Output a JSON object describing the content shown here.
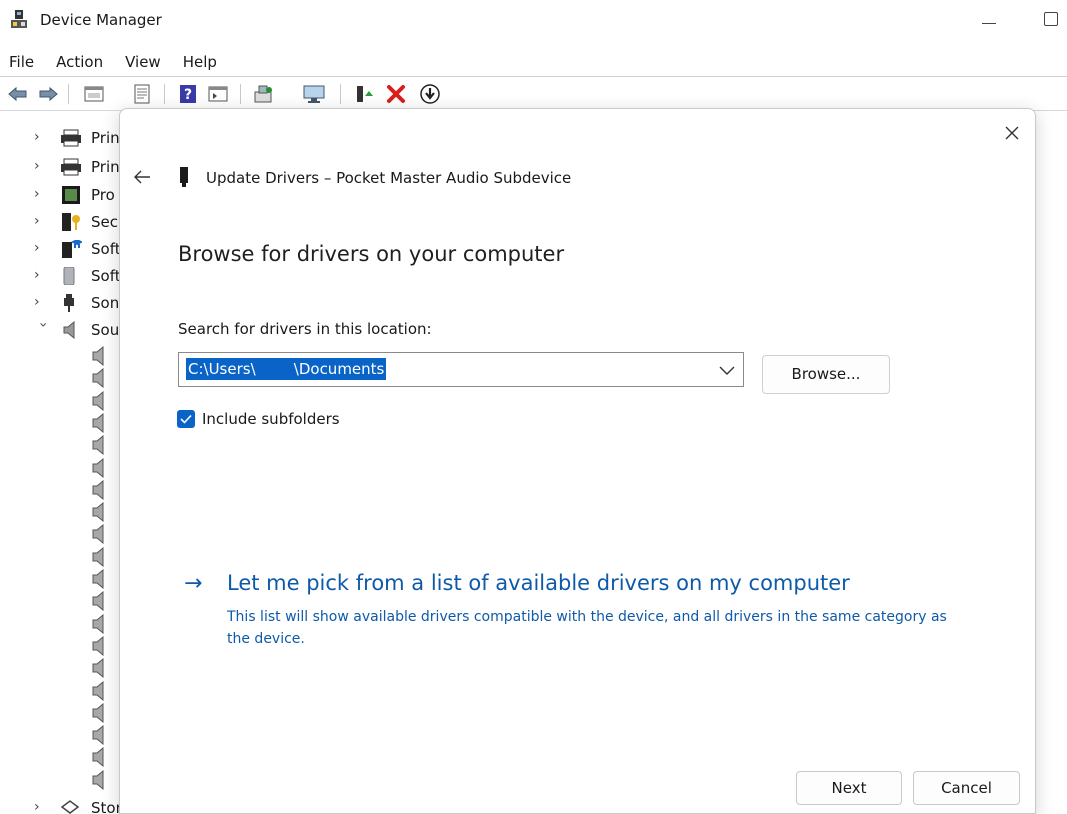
{
  "window": {
    "title": "Device Manager",
    "icon": "device-manager-icon"
  },
  "menu": [
    "File",
    "Action",
    "View",
    "Help"
  ],
  "toolbar_icons": [
    "back-icon",
    "forward-icon",
    "properties-icon",
    "console-icon",
    "help-icon",
    "view-icon",
    "scan-hardware-icon",
    "monitor-icon",
    "enable-device-icon",
    "uninstall-icon",
    "update-driver-icon"
  ],
  "tree": {
    "items": [
      {
        "label": "Prin",
        "icon": "printer-icon",
        "expanded": false
      },
      {
        "label": "Prin",
        "icon": "printer-icon",
        "expanded": false
      },
      {
        "label": "Pro",
        "icon": "processor-icon",
        "expanded": false
      },
      {
        "label": "Sec",
        "icon": "security-key-icon",
        "expanded": false
      },
      {
        "label": "Soft",
        "icon": "software-component-icon",
        "expanded": false
      },
      {
        "label": "Soft",
        "icon": "software-device-icon",
        "expanded": false
      },
      {
        "label": "Son",
        "icon": "sound-device-icon",
        "expanded": false
      },
      {
        "label": "Sou",
        "icon": "speaker-icon",
        "expanded": true
      }
    ],
    "last_item": {
      "label": "Stor",
      "icon": "storage-icon"
    }
  },
  "dialog": {
    "title": "Update Drivers – Pocket Master Audio Subdevice",
    "heading": "Browse for drivers on your computer",
    "search_label": "Search for drivers in this location:",
    "path_value": "C:\\Users\\        \\Documents",
    "browse_label": "Browse...",
    "include_subfolders_label": "Include subfolders",
    "include_subfolders_checked": true,
    "pick_link": "Let me pick from a list of available drivers on my computer",
    "pick_description": "This list will show available drivers compatible with the device, and all drivers in the same category as the device.",
    "next_label": "Next",
    "cancel_label": "Cancel"
  },
  "colors": {
    "accent": "#0a64c8",
    "link": "#0f5aa8"
  }
}
